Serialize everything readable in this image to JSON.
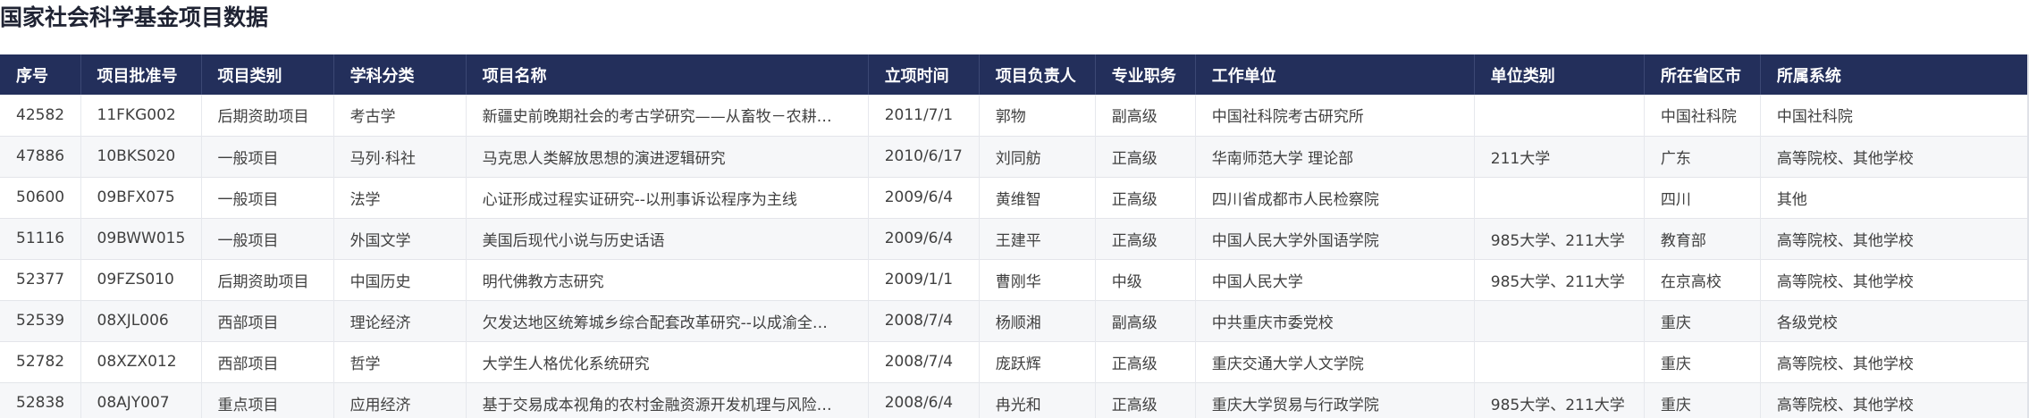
{
  "page": {
    "title": "国家社会科学基金项目数据"
  },
  "table": {
    "columns": [
      "序号",
      "项目批准号",
      "项目类别",
      "学科分类",
      "项目名称",
      "立项时间",
      "项目负责人",
      "专业职务",
      "工作单位",
      "单位类别",
      "所在省区市",
      "所属系统"
    ],
    "rows": [
      [
        "42582",
        "11FKG002",
        "后期资助项目",
        "考古学",
        "新疆史前晚期社会的考古学研究——从畜牧－农耕…",
        "2011/7/1",
        "郭物",
        "副高级",
        "中国社科院考古研究所",
        "",
        "中国社科院",
        "中国社科院"
      ],
      [
        "47886",
        "10BKS020",
        "一般项目",
        "马列·科社",
        "马克思人类解放思想的演进逻辑研究",
        "2010/6/17",
        "刘同舫",
        "正高级",
        "华南师范大学 理论部",
        "211大学",
        "广东",
        "高等院校、其他学校"
      ],
      [
        "50600",
        "09BFX075",
        "一般项目",
        "法学",
        "心证形成过程实证研究--以刑事诉讼程序为主线",
        "2009/6/4",
        "黄维智",
        "正高级",
        "四川省成都市人民检察院",
        "",
        "四川",
        "其他"
      ],
      [
        "51116",
        "09BWW015",
        "一般项目",
        "外国文学",
        "美国后现代小说与历史话语",
        "2009/6/4",
        "王建平",
        "正高级",
        "中国人民大学外国语学院",
        "985大学、211大学",
        "教育部",
        "高等院校、其他学校"
      ],
      [
        "52377",
        "09FZS010",
        "后期资助项目",
        "中国历史",
        "明代佛教方志研究",
        "2009/1/1",
        "曹刚华",
        "中级",
        "中国人民大学",
        "985大学、211大学",
        "在京高校",
        "高等院校、其他学校"
      ],
      [
        "52539",
        "08XJL006",
        "西部项目",
        "理论经济",
        "欠发达地区统筹城乡综合配套改革研究--以成渝全…",
        "2008/7/4",
        "杨顺湘",
        "副高级",
        "中共重庆市委党校",
        "",
        "重庆",
        "各级党校"
      ],
      [
        "52782",
        "08XZX012",
        "西部项目",
        "哲学",
        "大学生人格优化系统研究",
        "2008/7/4",
        "庞跃辉",
        "正高级",
        "重庆交通大学人文学院",
        "",
        "重庆",
        "高等院校、其他学校"
      ],
      [
        "52838",
        "08AJY007",
        "重点项目",
        "应用经济",
        "基于交易成本视角的农村金融资源开发机理与风险…",
        "2008/6/4",
        "冉光和",
        "正高级",
        "重庆大学贸易与行政学院",
        "985大学、211大学",
        "重庆",
        "高等院校、其他学校"
      ]
    ]
  }
}
